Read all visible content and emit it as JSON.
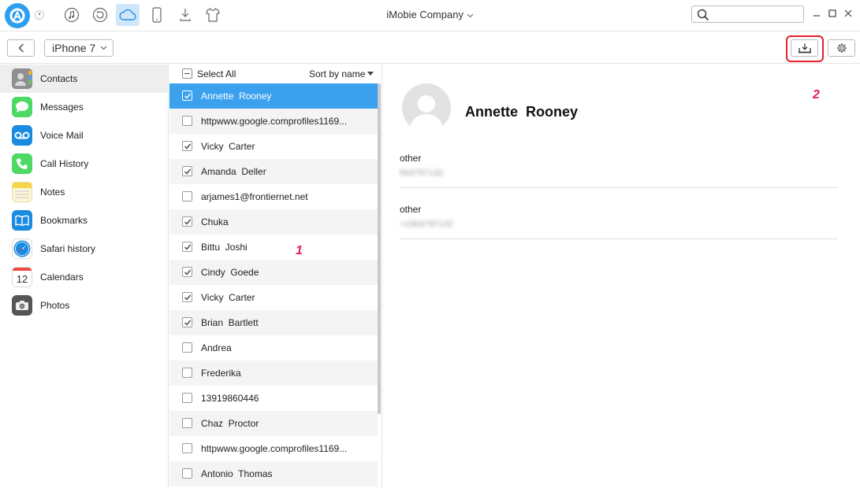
{
  "window": {
    "title": "iMobie Company",
    "search_placeholder": ""
  },
  "toolbar": {
    "device_name": "iPhone 7"
  },
  "sidebar": {
    "items": [
      {
        "label": "Contacts",
        "icon": "contacts-icon",
        "color": "#8e8e93",
        "active": true
      },
      {
        "label": "Messages",
        "icon": "messages-icon",
        "color": "#4cd964",
        "active": false
      },
      {
        "label": "Voice Mail",
        "icon": "voicemail-icon",
        "color": "#1a8be0",
        "active": false
      },
      {
        "label": "Call History",
        "icon": "phone-icon",
        "color": "#4cd964",
        "active": false
      },
      {
        "label": "Notes",
        "icon": "notes-icon",
        "color": "#f7d54a",
        "active": false
      },
      {
        "label": "Bookmarks",
        "icon": "bookmarks-icon",
        "color": "#1a8be0",
        "active": false
      },
      {
        "label": "Safari history",
        "icon": "safari-icon",
        "color": "#1a8be0",
        "active": false
      },
      {
        "label": "Calendars",
        "icon": "calendar-icon",
        "color": "#ffffff",
        "active": false
      },
      {
        "label": "Photos",
        "icon": "camera-icon",
        "color": "#555555",
        "active": false
      }
    ],
    "calendar_day": "12"
  },
  "list": {
    "select_all_label": "Select All",
    "sort_label": "Sort by name",
    "contacts": [
      {
        "name": "Annette  Rooney",
        "checked": true,
        "selected": true
      },
      {
        "name": "httpwww.google.comprofiles1169...",
        "checked": false,
        "selected": false
      },
      {
        "name": "Vicky  Carter",
        "checked": true,
        "selected": false
      },
      {
        "name": "Amanda  Deller",
        "checked": true,
        "selected": false
      },
      {
        "name": "arjames1@frontiernet.net",
        "checked": false,
        "selected": false
      },
      {
        "name": "Chuka",
        "checked": true,
        "selected": false
      },
      {
        "name": "Bittu  Joshi",
        "checked": true,
        "selected": false
      },
      {
        "name": "Cindy  Goede",
        "checked": true,
        "selected": false
      },
      {
        "name": "Vicky  Carter",
        "checked": true,
        "selected": false
      },
      {
        "name": "Brian  Bartlett",
        "checked": true,
        "selected": false
      },
      {
        "name": "Andrea",
        "checked": false,
        "selected": false
      },
      {
        "name": "Frederika",
        "checked": false,
        "selected": false
      },
      {
        "name": "13919860446",
        "checked": false,
        "selected": false
      },
      {
        "name": "Chaz  Proctor",
        "checked": false,
        "selected": false
      },
      {
        "name": "httpwww.google.comprofiles1169...",
        "checked": false,
        "selected": false
      },
      {
        "name": "Antonio  Thomas",
        "checked": false,
        "selected": false
      }
    ]
  },
  "detail": {
    "name": "Annette  Rooney",
    "fields": [
      {
        "label": "other",
        "value": "563797132"
      },
      {
        "label": "other",
        "value": "+1563797132"
      }
    ]
  },
  "annotations": {
    "step1": "1",
    "step2": "2",
    "highlight_color": "#e8202a"
  },
  "colors": {
    "accent": "#3ba1ef",
    "cloud_active": "#cfe7fb"
  }
}
